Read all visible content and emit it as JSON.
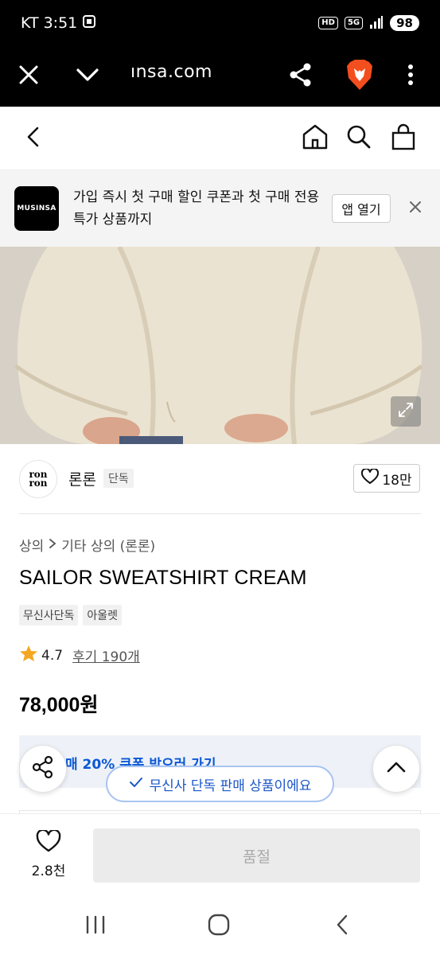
{
  "status_bar": {
    "carrier": "KT",
    "time": "3:51",
    "hd_badge": "HD",
    "network": "5G",
    "battery": "98"
  },
  "browser": {
    "url": "ınsa.com"
  },
  "banner": {
    "logo_text": "MUSINSA",
    "message": "가입 즉시 첫 구매 할인 쿠폰과 첫 구매 전용 특가 상품까지",
    "open_app_label": "앱 열기"
  },
  "brand": {
    "logo_line1": "ron",
    "logo_line2": "ron",
    "name": "론론",
    "exclusive_tag": "단독",
    "likes": "18만"
  },
  "breadcrumb": {
    "level1": "상의",
    "separator": ">",
    "level2": "기타 상의 (론론)"
  },
  "product": {
    "title": "SAILOR SWEATSHIRT CREAM",
    "tags": [
      "무신사단독",
      "아울렛"
    ],
    "rating": "4.7",
    "reviews": "후기 190개",
    "price": "78,000원"
  },
  "coupon": {
    "text": "매 20% 쿠폰 받으러 가기"
  },
  "toast": {
    "text": "무신사 단독 판매 상품이에요"
  },
  "bottom_bar": {
    "wish_count": "2.8천",
    "soldout_label": "품절"
  },
  "colors": {
    "accent_blue": "#1a56c9",
    "star": "#f5a623",
    "brave_orange": "#f24e1e"
  }
}
